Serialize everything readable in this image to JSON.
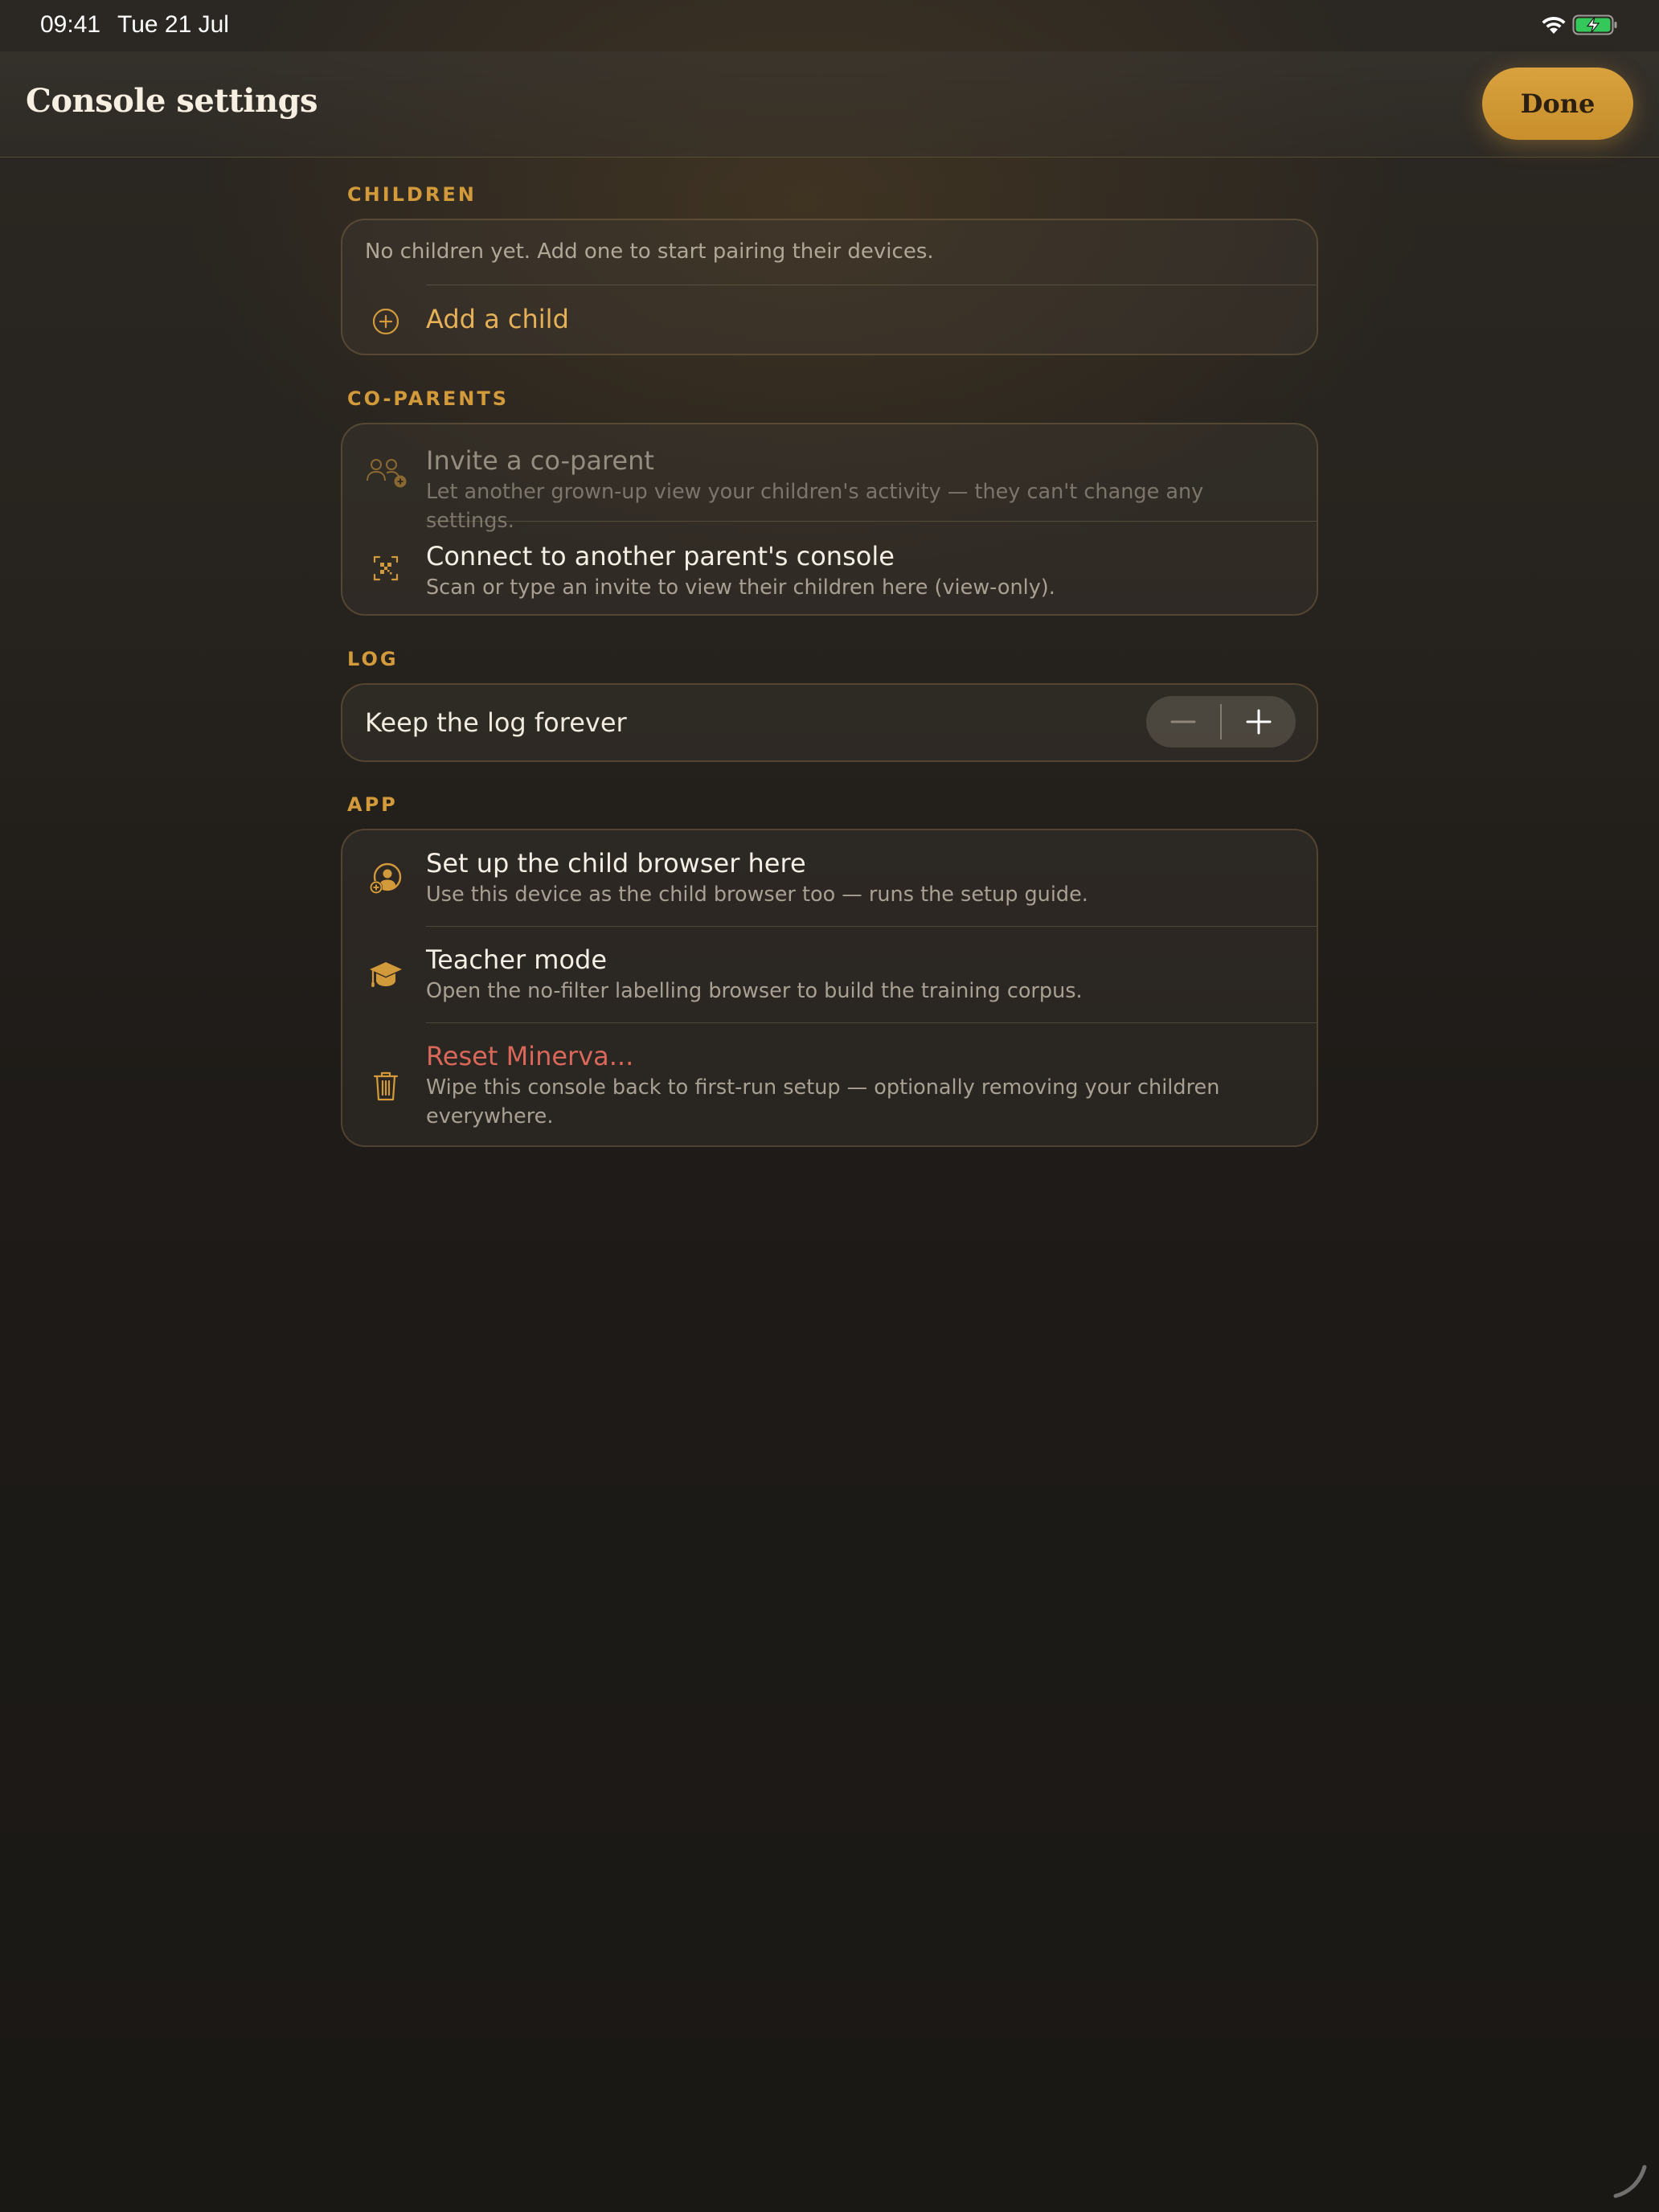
{
  "status_bar": {
    "time": "09:41",
    "date": "Tue 21 Jul",
    "icons": [
      "wifi-icon",
      "battery-charging-icon"
    ]
  },
  "nav": {
    "title": "Console settings",
    "done_label": "Done"
  },
  "sections": {
    "children": {
      "header": "CHILDREN",
      "empty_hint": "No children yet. Add one to start pairing their devices.",
      "add_child": {
        "label": "Add a child",
        "icon": "plus-circle-icon"
      }
    },
    "coparents": {
      "header": "CO-PARENTS",
      "invite": {
        "title": "Invite a co-parent",
        "subtitle": "Let another grown-up view your children's activity — they can't change any settings.",
        "icon": "person-add-icon",
        "disabled": true
      },
      "connect": {
        "title": "Connect to another parent's console",
        "subtitle": "Scan or type an invite to view their children here (view-only).",
        "icon": "qr-scan-icon"
      }
    },
    "log": {
      "header": "LOG",
      "retention_label": "Keep the log forever",
      "stepper": {
        "minus": "−",
        "plus": "+",
        "minus_enabled": false,
        "plus_enabled": true
      }
    },
    "app": {
      "header": "APP",
      "child_browser": {
        "title": "Set up the child browser here",
        "subtitle": "Use this device as the child browser too — runs the setup guide.",
        "icon": "child-profile-icon"
      },
      "teacher": {
        "title": "Teacher mode",
        "subtitle": "Open the no-filter labelling browser to build the training corpus.",
        "icon": "graduation-cap-icon"
      },
      "reset": {
        "title": "Reset Minerva...",
        "subtitle": "Wipe this console back to first-run setup — optionally removing your children everywhere.",
        "icon": "trash-icon"
      }
    }
  },
  "colors": {
    "accent": "#D39A3C",
    "done_button": "#D29A36",
    "danger": "#D9685A",
    "background": "#1E1B18"
  }
}
